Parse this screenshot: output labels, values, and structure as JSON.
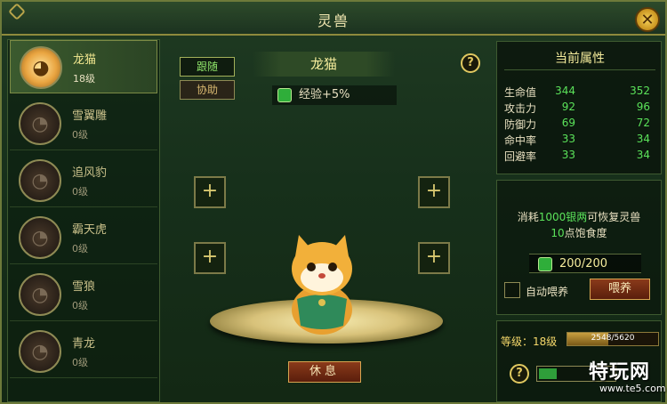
{
  "window": {
    "title": "灵兽"
  },
  "pets": [
    {
      "name": "龙猫",
      "level": "18级",
      "active": true
    },
    {
      "name": "雪翼雕",
      "level": "0级",
      "active": false
    },
    {
      "name": "追风豹",
      "level": "0级",
      "active": false
    },
    {
      "name": "霸天虎",
      "level": "0级",
      "active": false
    },
    {
      "name": "雪狼",
      "level": "0级",
      "active": false
    },
    {
      "name": "青龙",
      "level": "0级",
      "active": false
    }
  ],
  "center": {
    "tab_follow": "跟随",
    "tab_assist": "协助",
    "pet_name": "龙猫",
    "exp_bonus": "经验+5%",
    "help": "?",
    "slot_symbol": "+",
    "rest_button": "休息"
  },
  "attributes": {
    "header": "当前属性",
    "rows": [
      {
        "label": "生命值",
        "current": "344",
        "next": "352"
      },
      {
        "label": "攻击力",
        "current": "92",
        "next": "96"
      },
      {
        "label": "防御力",
        "current": "69",
        "next": "72"
      },
      {
        "label": "命中率",
        "current": "33",
        "next": "34"
      },
      {
        "label": "回避率",
        "current": "33",
        "next": "34"
      }
    ]
  },
  "feed": {
    "desc_prefix": "消耗",
    "desc_cost": "1000银两",
    "desc_suffix": "可恢复灵兽",
    "desc_amount": "10",
    "desc_tail": "点饱食度",
    "satiety": "200/200",
    "auto_feed_label": "自动喂养",
    "feed_button": "喂养"
  },
  "level": {
    "label": "等级：18级",
    "progress_text": "2548/5620",
    "progress_fraction": 0.453
  },
  "watermark": {
    "main": "特玩网",
    "sub": "www.te5.com"
  },
  "colors": {
    "accent_green": "#5be35a",
    "gold": "#f5ec9c",
    "button_red": "#8a3a1a"
  }
}
